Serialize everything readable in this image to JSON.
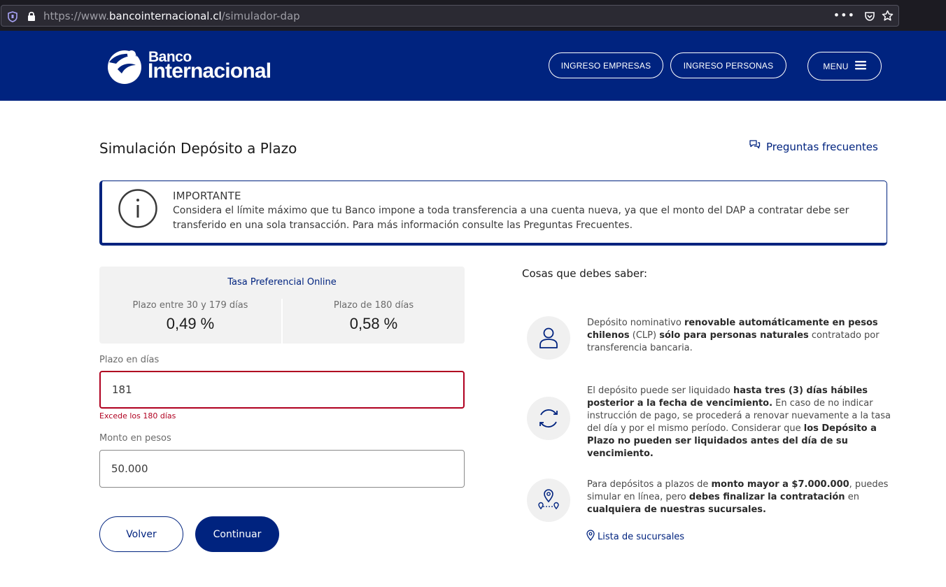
{
  "browser": {
    "url_prefix": "https://www.",
    "url_domain": "bancointernacional.cl",
    "url_path": "/simulador-dap"
  },
  "header": {
    "logo_small": "Banco",
    "logo_big": "Internacional",
    "btn_empresas": "INGRESO EMPRESAS",
    "btn_personas": "INGRESO PERSONAS",
    "btn_menu": "MENU"
  },
  "page": {
    "title": "Simulación Depósito a Plazo",
    "faq_link": "Preguntas frecuentes"
  },
  "alert": {
    "title": "IMPORTANTE",
    "text": "Considera el límite máximo que tu Banco impone a toda transferencia a una cuenta nueva, ya que el monto del DAP a contratar debe ser transferido en una sola transacción. Para más información consulte las Preguntas Frecuentes."
  },
  "rates": {
    "title": "Tasa Preferencial Online",
    "left_label": "Plazo entre 30 y 179 días",
    "left_value": "0,49 %",
    "right_label": "Plazo de 180 días",
    "right_value": "0,58 %"
  },
  "form": {
    "plazo_label": "Plazo en días",
    "plazo_value": "181",
    "plazo_error": "Excede los 180 días",
    "monto_label": "Monto en pesos",
    "monto_value": "50.000",
    "btn_volver": "Volver",
    "btn_continuar": "Continuar"
  },
  "info": {
    "title": "Cosas que debes saber:",
    "item1": {
      "a": "Depósito nominativo ",
      "b": "renovable automáticamente en pesos chilenos",
      "c": " (CLP) ",
      "d": "sólo para personas naturales",
      "e": " contratado por transferencia bancaria."
    },
    "item2": {
      "a": "El depósito puede ser liquidado ",
      "b": "hasta tres (3) días hábiles posterior a la fecha de vencimiento.",
      "c": " En caso de no indicar instrucción de pago, se procederá a renovar nuevamente a la tasa del día y por el mismo período. Considerar que ",
      "d": "los Depósito a Plazo no pueden ser liquidados antes del día de su vencimiento."
    },
    "item3": {
      "a": "Para depósitos a plazos de ",
      "b": "monto mayor a $7.000.000",
      "c": ", puedes simular en línea, pero ",
      "d": "debes finalizar la contratación",
      "e": " en ",
      "f": "cualquiera de nuestras sucursales."
    },
    "branches_link": "Lista de sucursales"
  },
  "colors": {
    "brand_blue": "#00237f",
    "error_red": "#b00020"
  },
  "icons": [
    "shield-icon",
    "lock-icon",
    "more-dots-icon",
    "pocket-icon",
    "star-icon",
    "logo-mark-icon",
    "hamburger-icon",
    "chat-bubbles-icon",
    "info-icon",
    "user-icon",
    "refresh-icon",
    "map-pins-icon",
    "pin-icon"
  ]
}
